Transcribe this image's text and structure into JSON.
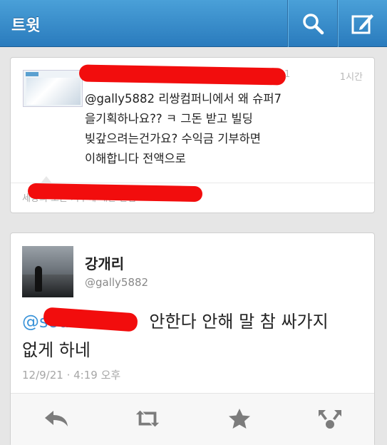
{
  "header": {
    "title": "트윗",
    "search_icon": "search-icon",
    "compose_icon": "compose-icon",
    "accent": "#2a7bbd"
  },
  "tweet1": {
    "time": "1시간",
    "digit": "1",
    "text": "@gally5882 리쌍컴퍼니에서 왜 슈퍼7\n을기획하나요?? ㅋ 그돈 받고 빌딩\n빚갚으려는건가요? 수익금 기부하면\n이해합니다 전액으로",
    "reply_bar": "세상의 모든 기부에 대한 관심"
  },
  "tweet2": {
    "display_name": "강개리",
    "screen_name": "@gally5882",
    "mention": "@sou",
    "text": "안한다 안해 말 참 싸가지\n없게 하네",
    "date": "12/9/21 · 4:19 오후"
  },
  "actions": [
    "reply-icon",
    "retweet-icon",
    "favorite-icon",
    "more-icon"
  ],
  "colors": {
    "mention": "#3b94d9",
    "redaction": "#f20d0d"
  }
}
